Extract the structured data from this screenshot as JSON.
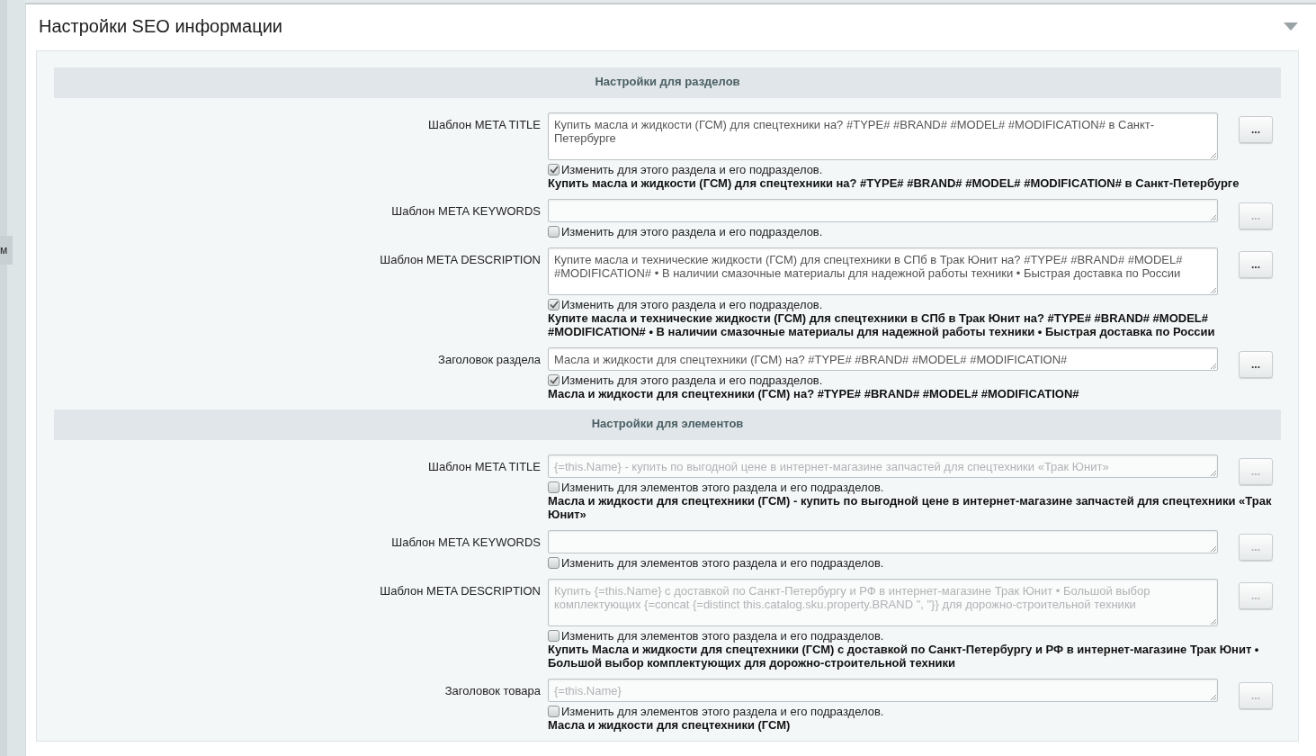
{
  "left_tab": {
    "label": "м"
  },
  "panel": {
    "title": "Настройки SEO информации",
    "expanded": true
  },
  "sections": [
    {
      "title": "Настройки для разделов",
      "rows": [
        {
          "label": "Шаблон META TITLE",
          "value": "Купить масла и жидкости (ГСМ) для спецтехники на? #TYPE# #BRAND# #MODEL# #MODIFICATION# в Санкт-Петербурге",
          "checked": true,
          "checkbox_label": "Изменить для этого раздела и его подразделов.",
          "preview": "Купить масла и жидкости (ГСМ) для спецтехники на? #TYPE# #BRAND# #MODEL# #MODIFICATION# в Санкт-Петербурге",
          "button": "..."
        },
        {
          "label": "Шаблон META KEYWORDS",
          "checked": false,
          "checkbox_label": "Изменить для этого раздела и его подразделов.",
          "button": "..."
        },
        {
          "label": "Шаблон META DESCRIPTION",
          "value": "Купите масла и технические жидкости (ГСМ) для спецтехники в СПб в Трак Юнит на? #TYPE# #BRAND# #MODEL# #MODIFICATION# • В наличии смазочные материалы для надежной работы техники • Быстрая доставка по России",
          "checked": true,
          "checkbox_label": "Изменить для этого раздела и его подразделов.",
          "preview": "Купите масла и технические жидкости (ГСМ) для спецтехники в СПб в Трак Юнит на? #TYPE# #BRAND# #MODEL# #MODIFICATION# • В наличии смазочные материалы для надежной работы техники • Быстрая доставка по России",
          "button": "..."
        },
        {
          "label": "Заголовок раздела",
          "value": "Масла и жидкости для спецтехники (ГСМ) на? #TYPE# #BRAND# #MODEL# #MODIFICATION#",
          "checked": true,
          "checkbox_label": "Изменить для этого раздела и его подразделов.",
          "preview": "Масла и жидкости для спецтехники (ГСМ) на? #TYPE# #BRAND# #MODEL# #MODIFICATION#",
          "button": "..."
        }
      ]
    },
    {
      "title": "Настройки для элементов",
      "rows": [
        {
          "label": "Шаблон META TITLE",
          "value": "{=this.Name} - купить по выгодной цене в интернет-магазине запчастей для спецтехники «Трак Юнит»",
          "checked": false,
          "checkbox_label": "Изменить для элементов этого раздела и его подразделов.",
          "preview": "Масла и жидкости для спецтехники (ГСМ) - купить по выгодной цене в интернет-магазине запчастей для спецтехники «Трак Юнит»",
          "button": "..."
        },
        {
          "label": "Шаблон META KEYWORDS",
          "checked": false,
          "checkbox_label": "Изменить для элементов этого раздела и его подразделов.",
          "button": "..."
        },
        {
          "label": "Шаблон META DESCRIPTION",
          "value": "Купить {=this.Name} с доставкой по Санкт-Петербургу и РФ в интернет-магазине Трак Юнит • Большой выбор комплектующих {=concat {=distinct this.catalog.sku.property.BRAND \", \"}} для дорожно-строительной техники",
          "checked": false,
          "checkbox_label": "Изменить для элементов этого раздела и его подразделов.",
          "preview": "Купить Масла и жидкости для спецтехники (ГСМ) с доставкой по Санкт-Петербургу и РФ в интернет-магазине Трак Юнит • Большой выбор комплектующих для дорожно-строительной техники",
          "button": "..."
        },
        {
          "label": "Заголовок товара",
          "value": "{=this.Name}",
          "checked": false,
          "checkbox_label": "Изменить для элементов этого раздела и его подразделов.",
          "preview": "Масла и жидкости для спецтехники (ГСМ)",
          "button": "..."
        }
      ]
    }
  ]
}
